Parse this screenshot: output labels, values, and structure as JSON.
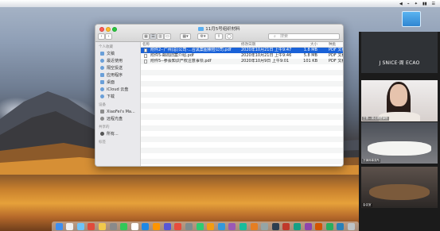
{
  "menubar": {
    "status_items": [
      "◀",
      "⌁",
      "✦",
      "▮▮",
      "☰"
    ]
  },
  "finder": {
    "title": "11月5号组织材料",
    "search_placeholder": "搜索",
    "toolbar": {
      "back": "‹",
      "forward": "›",
      "view_icons": "▦",
      "view_list": "☰",
      "view_columns": "▥",
      "view_gallery": "▭",
      "group": "▦▾",
      "action": "⚙▾",
      "share": "⇪",
      "tag": "◯"
    },
    "sidebar": {
      "favorites_header": "个人收藏",
      "favorites": [
        {
          "label": "文稿",
          "icon": "documents-icon"
        },
        {
          "label": "最近使用",
          "icon": "recents-icon"
        },
        {
          "label": "隔空投送",
          "icon": "airdrop-icon"
        },
        {
          "label": "应用程序",
          "icon": "applications-icon"
        },
        {
          "label": "桌面",
          "icon": "desktop-icon"
        },
        {
          "label": "iCloud 云盘",
          "icon": "icloud-icon"
        },
        {
          "label": "下载",
          "icon": "downloads-icon"
        }
      ],
      "devices_header": "设备",
      "devices": [
        {
          "label": "XiaoFei's Ma...",
          "icon": "laptop-icon"
        },
        {
          "label": "远程光盘",
          "icon": "remote-disc-icon"
        }
      ],
      "shared_header": "共享的",
      "shared": [
        {
          "label": "所有...",
          "icon": "network-icon"
        }
      ],
      "tags_header": "标签"
    },
    "columns": {
      "name": "名称",
      "date": "修改日期",
      "size": "大小",
      "kind": "种类"
    },
    "files": [
      {
        "name": "附件2-·广州(总)公司·...合黑案图索检公司.pdf",
        "date": "2020年10月21日 上午9:47",
        "size": "1.8 MB",
        "kind": "PDF 文稿",
        "selected": true
      },
      {
        "name": "附件5-邮局旧案介绍.pdf",
        "date": "2020年10月21日 上午9:46",
        "size": "5.8 MB",
        "kind": "PDF 文稿",
        "selected": false
      },
      {
        "name": "附件5--参会知识产权注意事项.pdf",
        "date": "2020年10月9日 上午9:01",
        "size": "101 KB",
        "kind": "PDF 文稿",
        "selected": false
      }
    ]
  },
  "video_panel": {
    "tiles": [
      {
        "label": "J SNICE·周 ECAO"
      },
      {
        "label": "王蕾—湖北博楚律所"
      },
      {
        "label": "万律师事务所"
      },
      {
        "label": "会议室"
      }
    ]
  },
  "dock": {
    "icon_colors": [
      "#3d8ef0",
      "#f0f0f0",
      "#6fc3f7",
      "#e14b3b",
      "#f2c94c",
      "#8a8a8a",
      "#34c759",
      "#ffffff",
      "#1e88e5",
      "#ff9500",
      "#5856d6",
      "#e74c3c",
      "#7f8c8d",
      "#2ecc71",
      "#f39c12",
      "#3498db",
      "#9b59b6",
      "#1abc9c",
      "#e67e22",
      "#95a5a6",
      "#2c3e50",
      "#c0392b",
      "#16a085",
      "#8e44ad",
      "#d35400",
      "#27ae60",
      "#2980b9",
      "#bdc3c7"
    ]
  }
}
